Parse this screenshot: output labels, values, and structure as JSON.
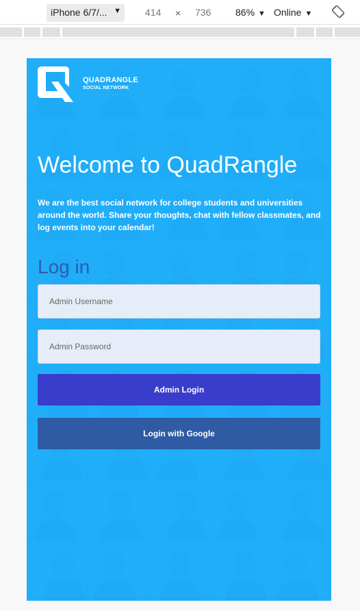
{
  "devtools": {
    "device": "iPhone 6/7/...",
    "width": "414",
    "separator": "×",
    "height": "736",
    "zoom": "86%",
    "network": "Online",
    "caret": "▼",
    "rotate_icon": "rotate-icon"
  },
  "brand": {
    "name": "QUADRANGLE",
    "tagline": "SOCIAL NETWORK",
    "logo_icon": "quadrangle-logo-icon"
  },
  "hero": {
    "title": "Welcome to QuadRangle",
    "description": "We are the best social network for college students and universities around the world. Share your thoughts, chat with fellow classmates, and log events into your calendar!"
  },
  "login": {
    "heading": "Log in",
    "username_placeholder": "Admin Username",
    "password_placeholder": "Admin Password",
    "admin_button": "Admin Login",
    "google_button": "Login with Google"
  },
  "colors": {
    "background": "#1eaefc",
    "heading": "#2e5bb0",
    "admin_button": "#3a3ccb",
    "google_button": "#2e5ba3",
    "field": "#e7edf8"
  }
}
